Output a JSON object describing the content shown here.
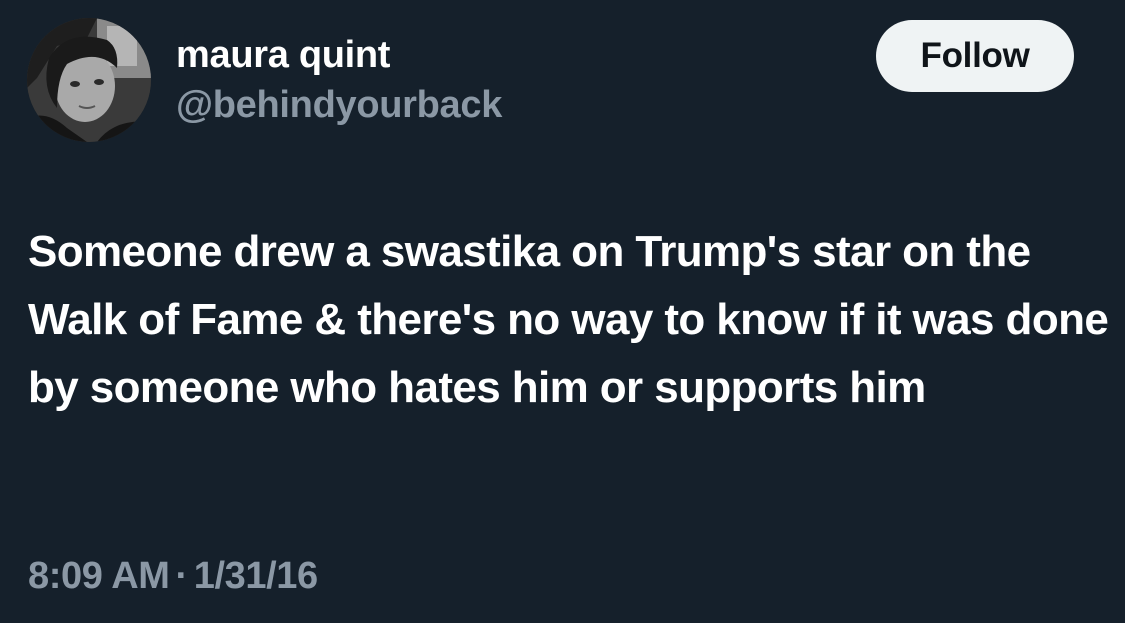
{
  "author": {
    "name": "maura quint",
    "handle": "@behindyourback"
  },
  "follow_label": "Follow",
  "tweet": {
    "text": "Someone drew a swastika on Trump's star on the Walk of Fame & there's no way to know if it was done by someone who hates him or supports him",
    "time": "8:09 AM",
    "separator": "·",
    "date": "1/31/16"
  },
  "colors": {
    "background": "#15202b",
    "primary_text": "#ffffff",
    "secondary_text": "#8b98a5",
    "follow_button_bg": "#eff3f4",
    "follow_button_text": "#0f1419"
  }
}
